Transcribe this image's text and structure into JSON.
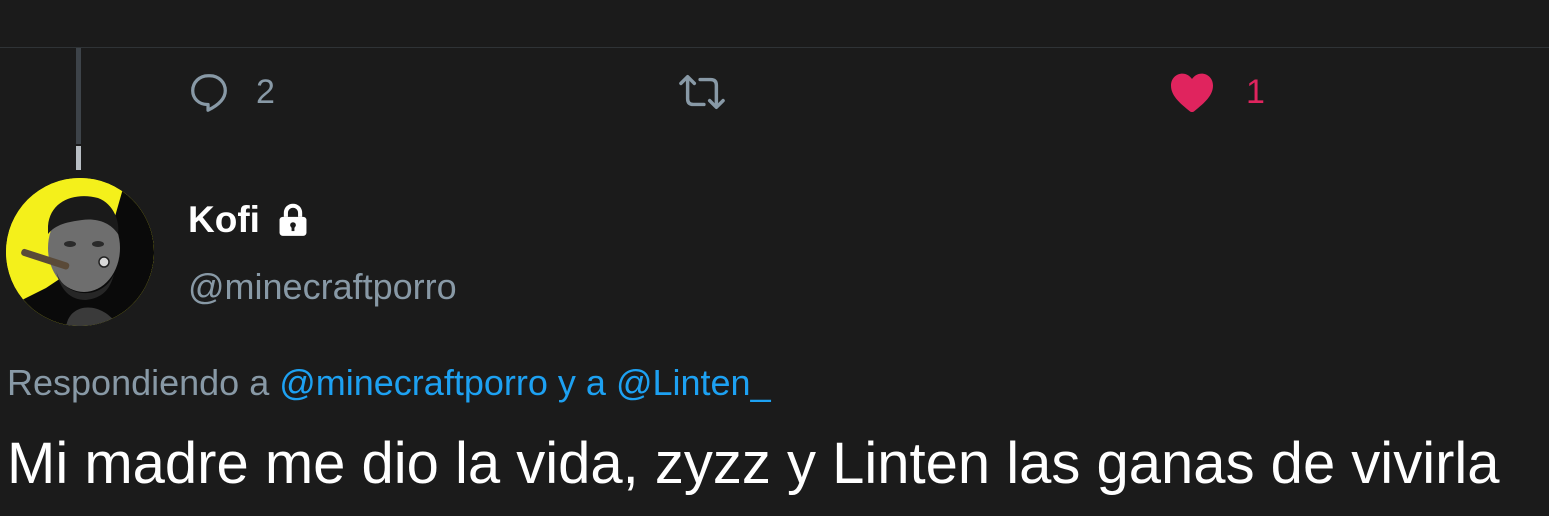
{
  "actions": {
    "reply_icon": "reply-bubble-icon",
    "reply_count": "2",
    "retweet_icon": "retweet-icon",
    "like_icon": "heart-icon",
    "like_count": "1",
    "like_color": "#e0245e"
  },
  "tweet": {
    "display_name": "Kofi",
    "lock_icon": "lock-icon",
    "handle": "@minecraftporro",
    "replying_prefix": "Respondiendo a",
    "replying_mention_1": "@minecraftporro",
    "replying_joiner": "y a",
    "replying_mention_2": "@Linten_",
    "text": "Mi madre me dio la vida, zyzz y Linten las ganas de vivirla"
  },
  "colors": {
    "background": "#1b1b1b",
    "muted_text": "#8899a6",
    "link": "#1da1f2",
    "avatar_background": "#f4f01b"
  }
}
